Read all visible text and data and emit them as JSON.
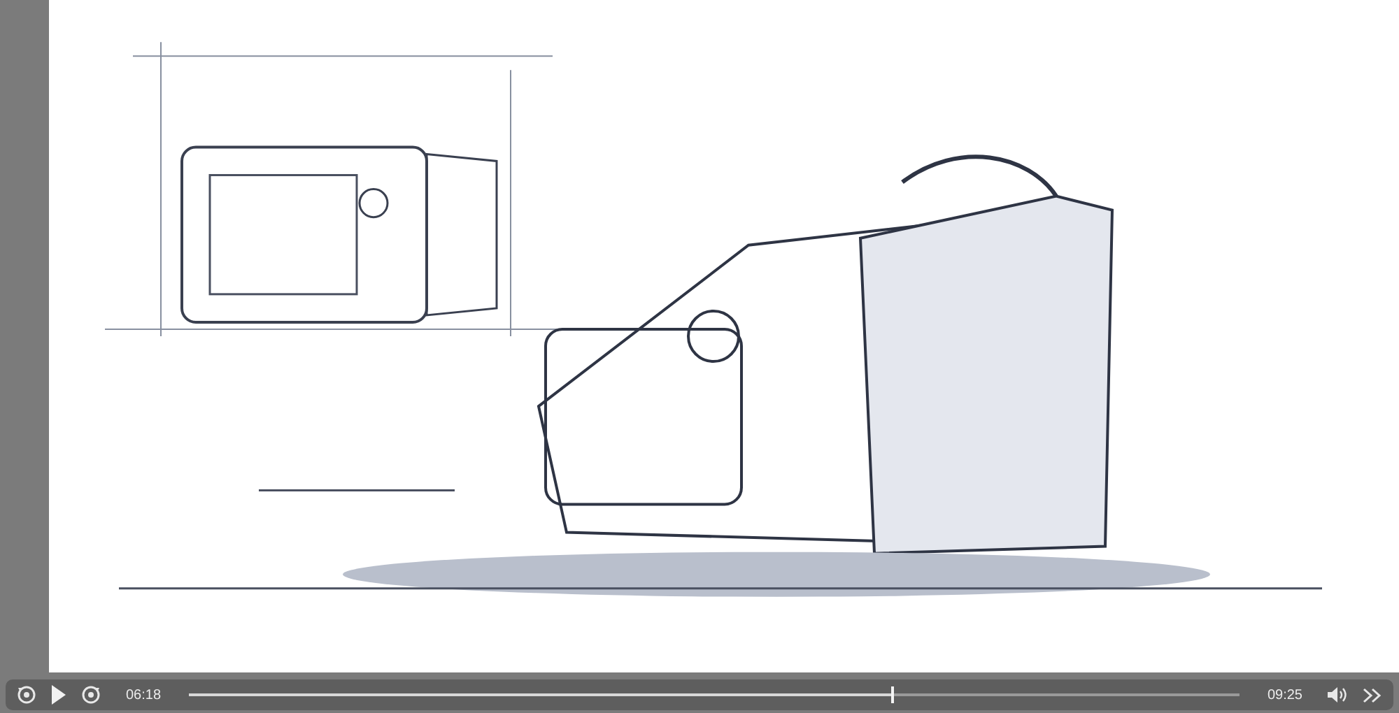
{
  "player": {
    "playing": false,
    "current_time": "06:18",
    "progress": {
      "level": 0.67
    },
    "duration": "09:25"
  }
}
